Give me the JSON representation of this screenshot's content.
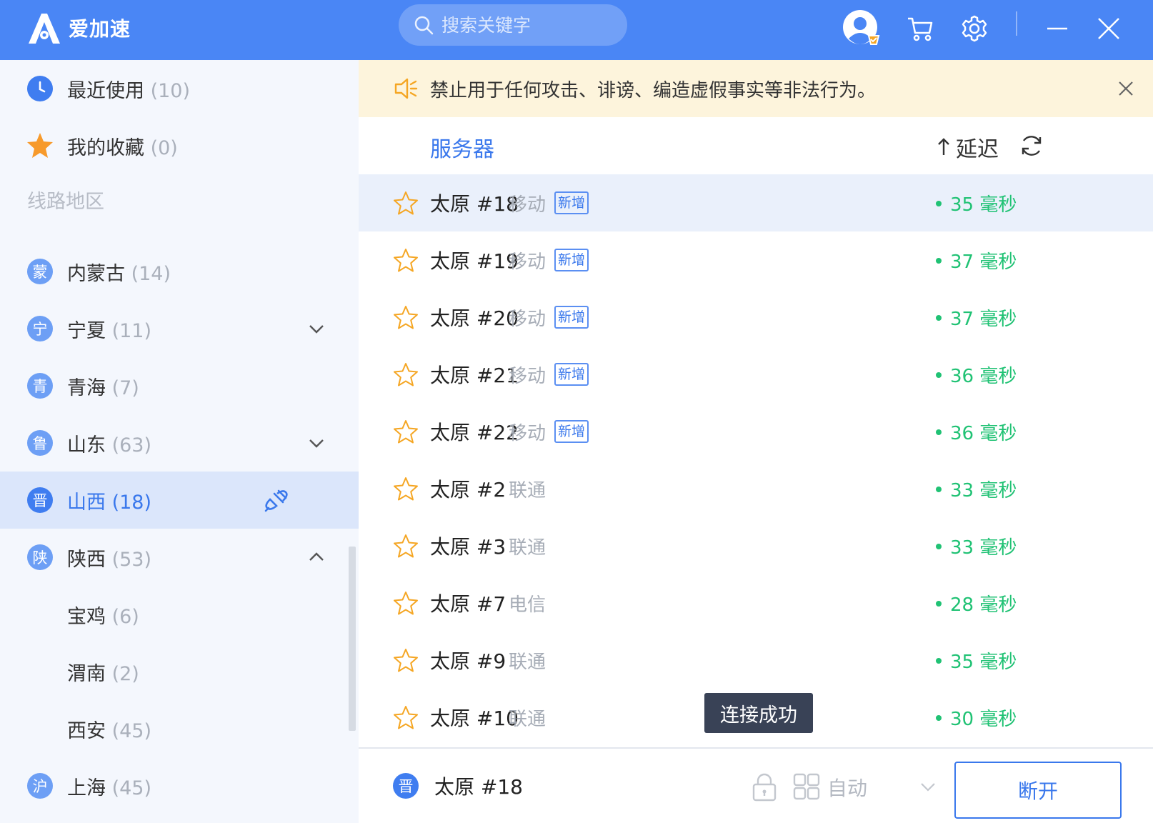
{
  "app": {
    "name": "爱加速"
  },
  "search": {
    "placeholder": "搜索关键字"
  },
  "sidebar": {
    "recent": {
      "label": "最近使用",
      "count": "(10)"
    },
    "favorites": {
      "label": "我的收藏",
      "count": "(0)"
    },
    "section_label": "线路地区",
    "regions": [
      {
        "icon_char": "蒙",
        "label": "内蒙古",
        "count": "(14)"
      },
      {
        "icon_char": "宁",
        "label": "宁夏",
        "count": "(11)"
      },
      {
        "icon_char": "青",
        "label": "青海",
        "count": "(7)"
      },
      {
        "icon_char": "鲁",
        "label": "山东",
        "count": "(63)"
      },
      {
        "icon_char": "晋",
        "label": "山西",
        "count": "(18)"
      },
      {
        "icon_char": "陕",
        "label": "陕西",
        "count": "(53)"
      }
    ],
    "sub_regions": [
      {
        "label": "宝鸡",
        "count": "(6)"
      },
      {
        "label": "渭南",
        "count": "(2)"
      },
      {
        "label": "西安",
        "count": "(45)"
      }
    ],
    "last_region": {
      "icon_char": "沪",
      "label": "上海",
      "count": "(45)"
    }
  },
  "notice": {
    "text": "禁止用于任何攻击、诽谤、编造虚假事实等非法行为。"
  },
  "table": {
    "col_server": "服务器",
    "col_latency": "延迟",
    "rows": [
      {
        "name": "太原 #18",
        "isp": "移动",
        "tag": "新增",
        "latency": "35 毫秒"
      },
      {
        "name": "太原 #19",
        "isp": "移动",
        "tag": "新增",
        "latency": "37 毫秒"
      },
      {
        "name": "太原 #20",
        "isp": "移动",
        "tag": "新增",
        "latency": "37 毫秒"
      },
      {
        "name": "太原 #21",
        "isp": "移动",
        "tag": "新增",
        "latency": "36 毫秒"
      },
      {
        "name": "太原 #22",
        "isp": "移动",
        "tag": "新增",
        "latency": "36 毫秒"
      },
      {
        "name": "太原 #2",
        "isp": "联通",
        "tag": "",
        "latency": "33 毫秒"
      },
      {
        "name": "太原 #3",
        "isp": "联通",
        "tag": "",
        "latency": "33 毫秒"
      },
      {
        "name": "太原 #7",
        "isp": "电信",
        "tag": "",
        "latency": "28 毫秒"
      },
      {
        "name": "太原 #9",
        "isp": "联通",
        "tag": "",
        "latency": "35 毫秒"
      },
      {
        "name": "太原 #10",
        "isp": "联通",
        "tag": "",
        "latency": "30 毫秒"
      }
    ]
  },
  "toast": {
    "text": "连接成功"
  },
  "bottom": {
    "region_char": "晋",
    "current_server": "太原 #18",
    "mode_label": "自动",
    "disconnect_label": "断开"
  },
  "colors": {
    "accent": "#4a86f5",
    "latency_green": "#20c274",
    "star_orange": "#f5a623"
  }
}
